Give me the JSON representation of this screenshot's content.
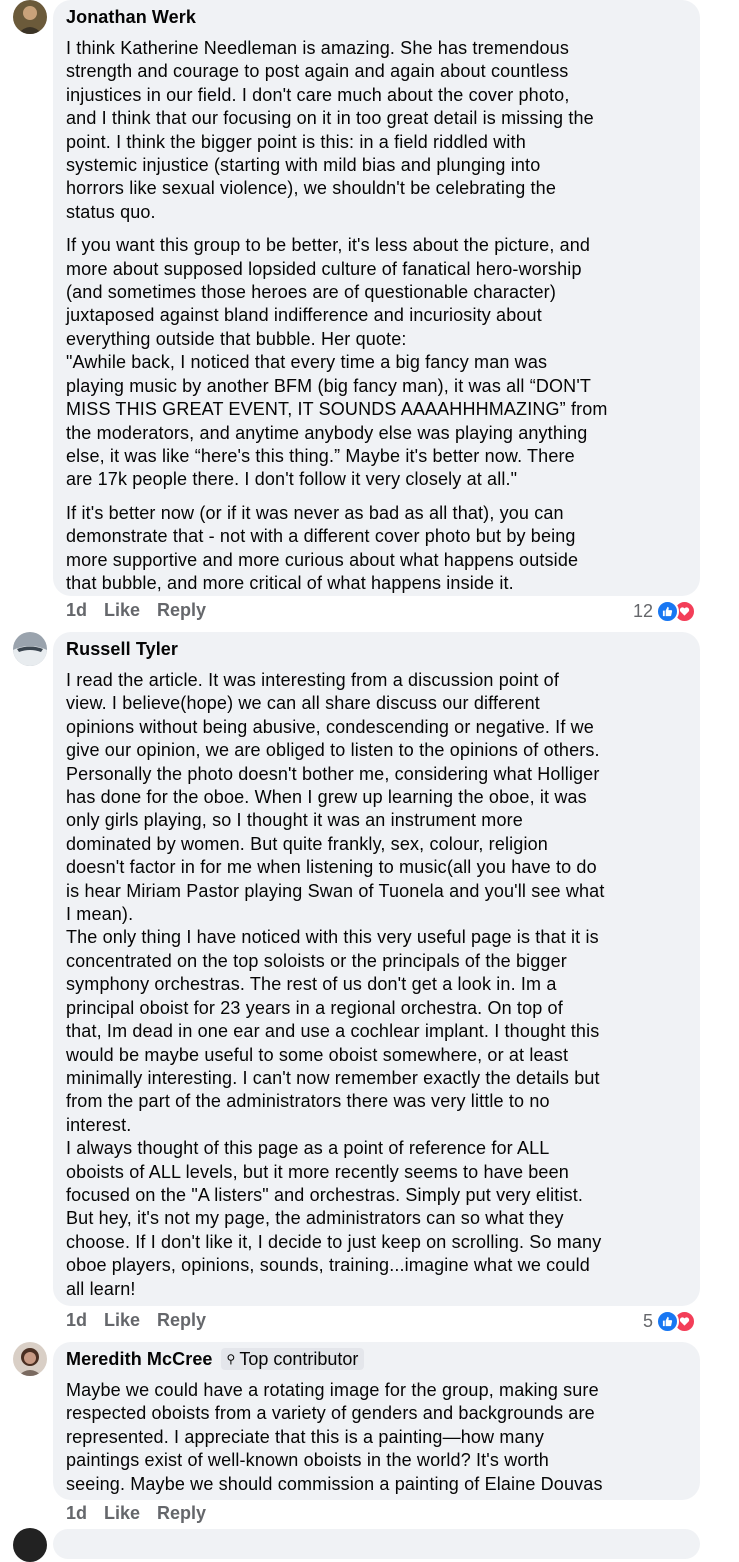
{
  "colors": {
    "bubble": "#f0f2f5",
    "meta_text": "#65676b",
    "like_blue": "#1877f2",
    "love_red": "#f33e58"
  },
  "comments": [
    {
      "author": "Jonathan Werk",
      "paragraphs": [
        "I think Katherine Needleman is amazing. She has tremendous\nstrength and courage to post again and again about countless\ninjustices in our field. I don't care much about the cover photo,\nand I think that our focusing on it in too great detail is missing the\npoint. I think the bigger point is this: in a field riddled with\nsystemic injustice (starting with mild bias and plunging into\nhorrors like sexual violence), we shouldn't be celebrating the\nstatus quo.",
        "If you want this group to be better, it's less about the picture, and\nmore about supposed lopsided culture of fanatical hero-worship\n(and sometimes those heroes are of questionable character)\njuxtaposed against bland indifference and incuriosity about\neverything outside that bubble. Her quote:\n\"Awhile back, I noticed that every time a big fancy man was\nplaying music by another BFM (big fancy man), it was all “DON'T\nMISS THIS GREAT EVENT, IT SOUNDS AAAAHHHMAZING” from\nthe moderators, and anytime anybody else was playing anything\nelse, it was like “here's this thing.” Maybe it's better now. There\nare 17k people there. I don't follow it very closely at all.\"",
        "If it's better now (or if it was never as bad as all that), you can\ndemonstrate that - not with a different cover photo but by being\nmore supportive and more curious about what happens outside\nthat bubble, and more critical of what happens inside it."
      ],
      "time": "1d",
      "like_label": "Like",
      "reply_label": "Reply",
      "reaction_count": "12",
      "reaction_icons": [
        "like-icon",
        "love-icon"
      ]
    },
    {
      "author": "Russell Tyler",
      "paragraphs": [
        "I read the article. It was interesting from a discussion point of\nview. I believe(hope) we can all share discuss our different\nopinions without being abusive, condescending or negative. If we\ngive our opinion, we are obliged to listen to the opinions of others.\nPersonally the photo doesn't bother me, considering what Holliger\nhas done for the oboe. When I grew up learning the oboe, it was\nonly girls playing, so I thought it was an instrument more\ndominated by women. But quite frankly, sex, colour, religion\ndoesn't factor in for me when listening to music(all you have to do\nis hear Miriam Pastor playing Swan of Tuonela and you'll see what\nI mean).\nThe only thing I have noticed with this very useful page is that it is\nconcentrated on the top soloists or the principals of the bigger\nsymphony orchestras. The rest of us don't get a look in. Im a\nprincipal oboist for 23 years in a regional orchestra. On top of\nthat, Im dead in one ear and use a cochlear implant. I thought this\nwould be maybe useful to some oboist somewhere, or at least\nminimally interesting. I can't now remember exactly the details but\nfrom the part of the administrators there was very little to no\ninterest.\nI always thought of this page as a point of reference for ALL\noboists of ALL levels, but it more recently seems to have been\nfocused on the \"A listers\" and orchestras. Simply put very elitist.\nBut hey, it's not my page, the administrators can so what they\nchoose. If I don't like it, I decide to just keep on scrolling. So many\noboe players, opinions, sounds, training...imagine what we could\nall learn!"
      ],
      "time": "1d",
      "like_label": "Like",
      "reply_label": "Reply",
      "reaction_count": "5",
      "reaction_icons": [
        "like-icon",
        "love-icon"
      ]
    },
    {
      "author": "Meredith McCree",
      "badge": "Top contributor",
      "paragraphs": [
        "Maybe we could have a rotating image for the group, making sure\nrespected oboists from a variety of genders and backgrounds are\nrepresented. I appreciate that this is a painting—how many\npaintings exist of well-known oboists in the world? It's worth\nseeing. Maybe we should commission a painting of Elaine Douvas"
      ],
      "time": "1d",
      "like_label": "Like",
      "reply_label": "Reply"
    }
  ]
}
